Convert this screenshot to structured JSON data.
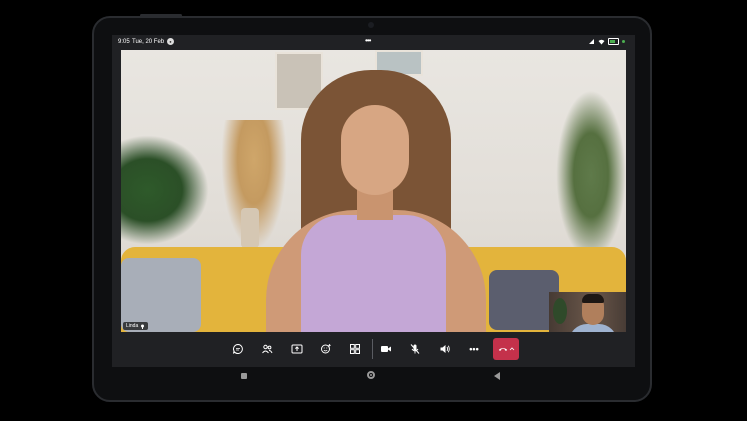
{
  "status_bar": {
    "time": "9:05",
    "date": "Tue, 20 Feb",
    "more_dots": "•••"
  },
  "call": {
    "main_participant_name": "Linda",
    "controls": [
      {
        "name": "chat-icon"
      },
      {
        "name": "people-icon"
      },
      {
        "name": "share-screen-icon"
      },
      {
        "name": "reactions-icon"
      },
      {
        "name": "view-grid-icon"
      },
      {
        "name": "camera-icon"
      },
      {
        "name": "mic-muted-icon"
      },
      {
        "name": "speaker-icon"
      },
      {
        "name": "more-icon"
      },
      {
        "name": "hang-up-icon"
      }
    ],
    "more_label": "•••",
    "hangup_color": "#c4314b"
  },
  "colors": {
    "control_bar": "#202124",
    "accent_green": "#4caf50"
  }
}
